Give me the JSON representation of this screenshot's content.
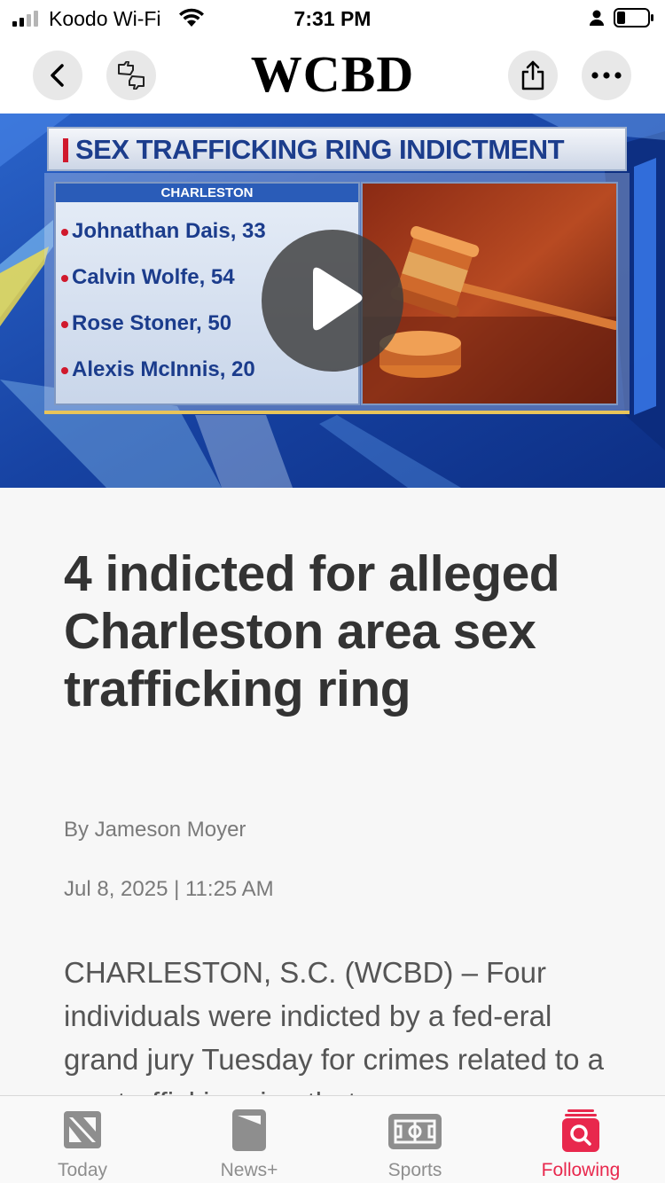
{
  "status_bar": {
    "carrier": "Koodo Wi-Fi",
    "time": "7:31 PM"
  },
  "nav": {
    "title": "WCBD"
  },
  "hero": {
    "banner": "SEX TRAFFICKING RING INDICTMENT",
    "list_header": "CHARLESTON",
    "names": [
      "Johnathan Dais, 33",
      "Calvin Wolfe, 54",
      "Rose Stoner, 50",
      "Alexis McInnis, 20"
    ]
  },
  "article": {
    "headline": "4 indicted for alleged Charleston area sex trafficking ring",
    "byline": "By Jameson Moyer",
    "date": "Jul 8, 2025 | 11:25 AM",
    "body": "CHARLESTON, S.C. (WCBD) – Four individuals were indicted by a fed-eral grand jury Tuesday for crimes related to a sex trafficking ring that"
  },
  "tabs": [
    {
      "label": "Today",
      "icon": "news-today-icon",
      "active": false
    },
    {
      "label": "News+",
      "icon": "news-plus-icon",
      "active": false
    },
    {
      "label": "Sports",
      "icon": "sports-field-icon",
      "active": false
    },
    {
      "label": "Following",
      "icon": "following-search-icon",
      "active": true
    }
  ],
  "colors": {
    "accent": "#e8284d",
    "headline": "#333333",
    "meta": "#7a7a7a"
  }
}
